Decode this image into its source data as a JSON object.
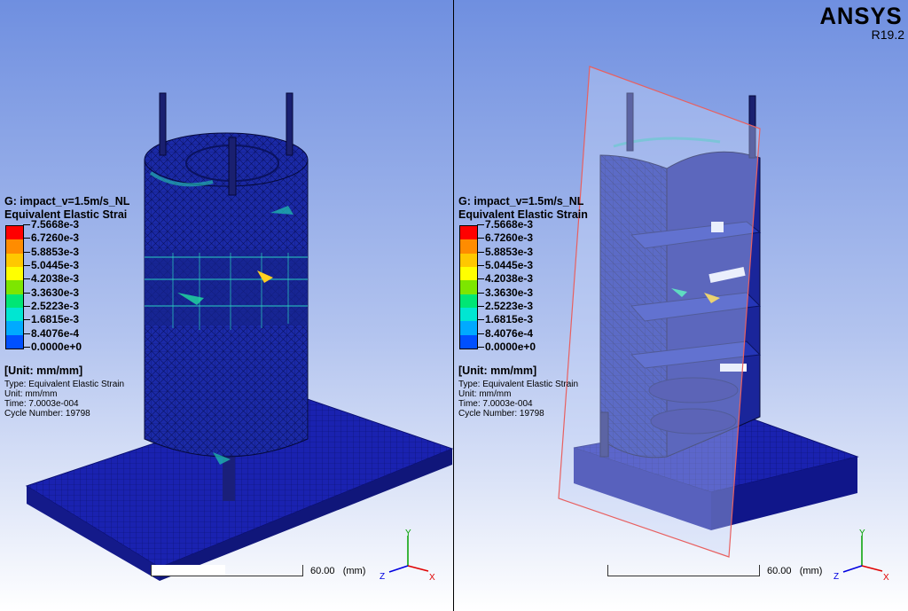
{
  "branding": {
    "name": "ANSYS",
    "version": "R19.2"
  },
  "legend": {
    "title_line1": "G: impact_v=1.5m/s_NL",
    "title_line2_left": "Equivalent Elastic Strai",
    "title_line2_right": "Equivalent Elastic Strain",
    "levels": [
      {
        "label": "7.5668e-3",
        "color": "#ff0000"
      },
      {
        "label": "6.7260e-3",
        "color": "#ff8c00"
      },
      {
        "label": "5.8853e-3",
        "color": "#ffc800"
      },
      {
        "label": "5.0445e-3",
        "color": "#ffff00"
      },
      {
        "label": "4.2038e-3",
        "color": "#7de600"
      },
      {
        "label": "3.3630e-3",
        "color": "#00e675"
      },
      {
        "label": "2.5223e-3",
        "color": "#00e6d2"
      },
      {
        "label": "1.6815e-3",
        "color": "#00aaff"
      },
      {
        "label": "8.4076e-4",
        "color": "#0050ff"
      },
      {
        "label": "0.0000e+0",
        "color": "#0000c8"
      }
    ],
    "unit": "[Unit: mm/mm]",
    "type": "Type: Equivalent Elastic Strain",
    "unit_line": "Unit: mm/mm",
    "time": "Time: 7.0003e-004",
    "cycle": "Cycle Number: 19798"
  },
  "scale": {
    "value": "60.00",
    "unit": "(mm)"
  },
  "triad": {
    "x": "X",
    "y": "Y",
    "z": "Z"
  },
  "colors": {
    "mesh_body": "#1b2a9e",
    "mesh_dark": "#0d1560",
    "base_plate": "#1a1fa0",
    "section_plane": "#e86060"
  }
}
